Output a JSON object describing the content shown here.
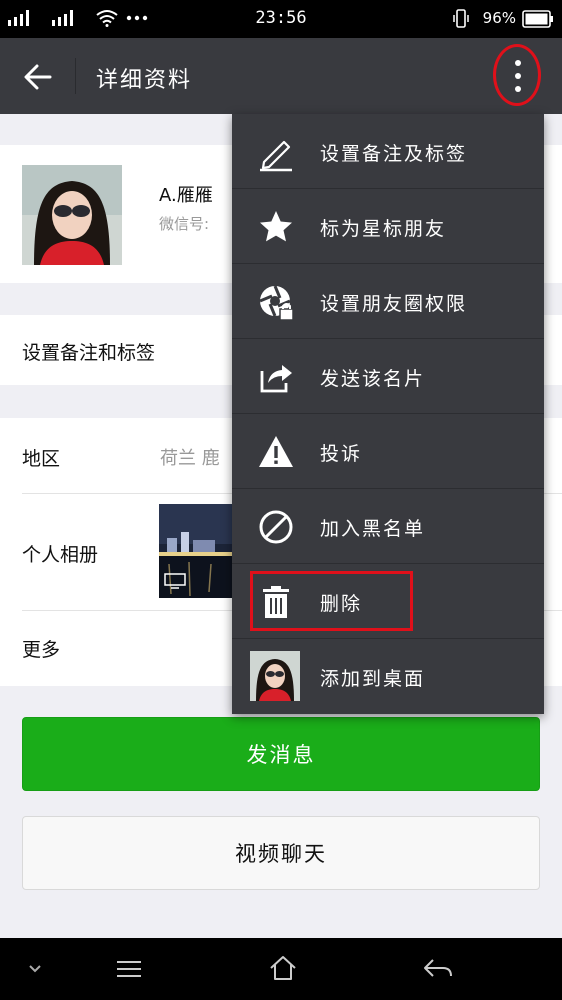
{
  "status_bar": {
    "time": "23:56",
    "battery": "96%"
  },
  "app_bar": {
    "title": "详细资料"
  },
  "profile": {
    "name": "A.雁雁",
    "wechat_id_label": "微信号:"
  },
  "remark_row": {
    "label": "设置备注和标签"
  },
  "region_row": {
    "label": "地区",
    "value": "荷兰 鹿"
  },
  "album_row": {
    "label": "个人相册"
  },
  "more_row": {
    "label": "更多"
  },
  "buttons": {
    "send_message": "发消息",
    "video_chat": "视频聊天"
  },
  "menu": {
    "items": [
      {
        "label": "设置备注及标签",
        "icon": "pencil-icon"
      },
      {
        "label": "标为星标朋友",
        "icon": "star-icon"
      },
      {
        "label": "设置朋友圈权限",
        "icon": "aperture-lock-icon"
      },
      {
        "label": "发送该名片",
        "icon": "share-icon"
      },
      {
        "label": "投诉",
        "icon": "warning-icon"
      },
      {
        "label": "加入黑名单",
        "icon": "block-icon"
      },
      {
        "label": "删除",
        "icon": "trash-icon"
      },
      {
        "label": "添加到桌面",
        "icon": "avatar-thumb"
      }
    ]
  },
  "highlight_color": "#e0101a",
  "accent_color": "#1aad19"
}
